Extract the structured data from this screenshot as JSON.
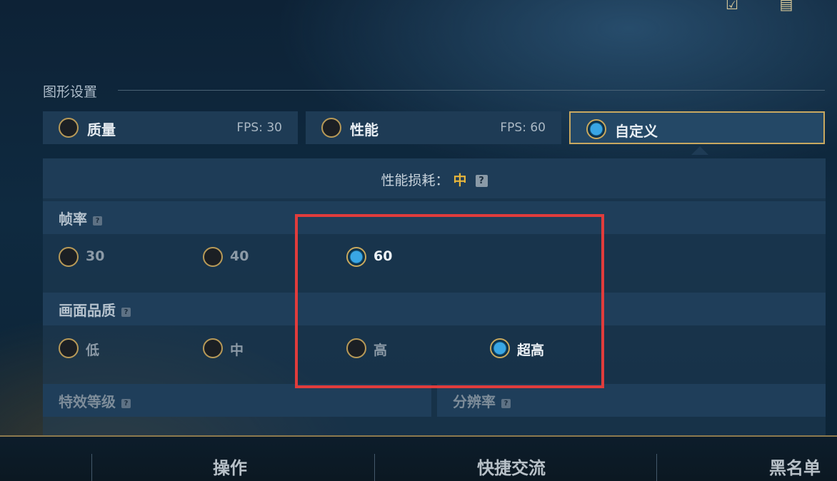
{
  "top_icons": [
    "checkbox-icon",
    "chat-icon"
  ],
  "section": {
    "title": "图形设置"
  },
  "modes": [
    {
      "label": "质量",
      "fps": "FPS: 30",
      "selected": false
    },
    {
      "label": "性能",
      "fps": "FPS: 60",
      "selected": false
    },
    {
      "label": "自定义",
      "fps": "",
      "selected": true
    }
  ],
  "cost": {
    "label": "性能损耗：",
    "value": "中",
    "help": "?"
  },
  "frame_rate": {
    "title": "帧率",
    "help": "?",
    "options": [
      {
        "label": "30",
        "selected": false
      },
      {
        "label": "40",
        "selected": false
      },
      {
        "label": "60",
        "selected": true
      }
    ]
  },
  "quality": {
    "title": "画面品质",
    "help": "?",
    "options": [
      {
        "label": "低",
        "selected": false
      },
      {
        "label": "中",
        "selected": false
      },
      {
        "label": "高",
        "selected": false
      },
      {
        "label": "超高",
        "selected": true
      }
    ]
  },
  "effects": {
    "title": "特效等级",
    "help": "?"
  },
  "resolution": {
    "title": "分辨率",
    "help": "?"
  },
  "bottom_tabs": [
    "操作",
    "快捷交流",
    "黑名单"
  ],
  "colors": {
    "accent_gold": "#c8a860",
    "cost_value": "#e6b53b",
    "highlight": "#e03c3c",
    "radio_on": "#39a6e4"
  }
}
